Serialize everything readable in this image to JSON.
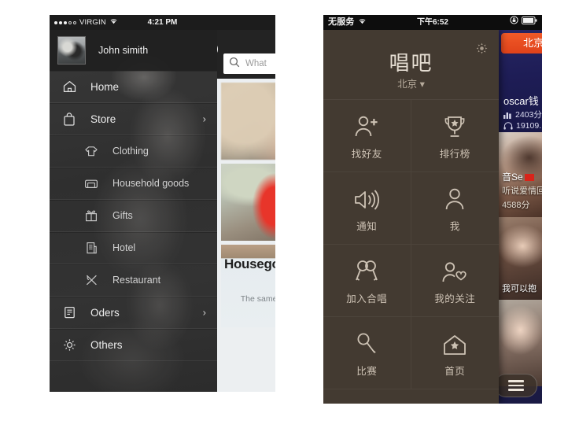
{
  "left_phone": {
    "status_bar": {
      "signal_dots_filled": 3,
      "signal_dots_hollow": 2,
      "carrier": "VIRGIN",
      "wifi_icon": "wifi-icon",
      "time": "4:21 PM"
    },
    "profile": {
      "avatar": "user-avatar-photo",
      "name": "John simith"
    },
    "menu": [
      {
        "label": "Home",
        "icon": "home-icon",
        "level": "top",
        "chevron": ""
      },
      {
        "label": "Store",
        "icon": "bag-icon",
        "level": "top",
        "chevron": "›"
      },
      {
        "label": "Clothing",
        "icon": "tshirt-icon",
        "level": "sub",
        "chevron": ""
      },
      {
        "label": "Household goods",
        "icon": "sofa-icon",
        "level": "sub",
        "chevron": ""
      },
      {
        "label": "Gifts",
        "icon": "gift-icon",
        "level": "sub",
        "chevron": ""
      },
      {
        "label": "Hotel",
        "icon": "building-icon",
        "level": "sub",
        "chevron": ""
      },
      {
        "label": "Restaurant",
        "icon": "cutlery-icon",
        "level": "sub",
        "chevron": ""
      },
      {
        "label": "Oders",
        "icon": "document-icon",
        "level": "top",
        "chevron": "›"
      },
      {
        "label": "Others",
        "icon": "gear-icon",
        "level": "top",
        "chevron": ""
      }
    ],
    "topbar": {
      "menu_icon": "hamburger-icon",
      "search_icon": "search-icon"
    },
    "search": {
      "icon": "search-icon",
      "placeholder": "What"
    },
    "cards": [
      {
        "type": "image",
        "name": "card-photo-desk"
      },
      {
        "type": "image",
        "name": "card-photo-red-ribbon"
      },
      {
        "type": "text",
        "headline": "House\ngoods",
        "body": "The same t\nbet\nyou  and"
      }
    ]
  },
  "right_phone": {
    "status_bar": {
      "carrier": "无服务",
      "wifi_icon": "wifi-icon",
      "time": "下午6:52",
      "lock_icon": "rotation-lock-icon",
      "battery_icon": "battery-icon"
    },
    "header": {
      "gear_icon": "gear-icon",
      "title": "唱吧",
      "city": "北京 ▾"
    },
    "grid": [
      {
        "label": "找好友",
        "icon": "add-friend-icon"
      },
      {
        "label": "排行榜",
        "icon": "trophy-icon"
      },
      {
        "label": "通知",
        "icon": "speaker-icon"
      },
      {
        "label": "我",
        "icon": "person-icon"
      },
      {
        "label": "加入合唱",
        "icon": "dual-mic-icon"
      },
      {
        "label": "我的关注",
        "icon": "person-heart-icon"
      },
      {
        "label": "比赛",
        "icon": "mic-icon"
      },
      {
        "label": "首页",
        "icon": "home-star-icon"
      }
    ],
    "feed": {
      "city_button": "北京",
      "items": [
        {
          "name": "oscar钱",
          "score_icon": "chart-icon",
          "score": "2403分",
          "plays_icon": "headphone-icon",
          "plays": "19109."
        },
        {
          "line1": "音Se",
          "line2": "听说爱情回",
          "line3": "4588分"
        },
        {
          "line1": "我可以抱"
        },
        {
          "line1": ""
        }
      ],
      "fab_icon": "hamburger-icon"
    }
  }
}
